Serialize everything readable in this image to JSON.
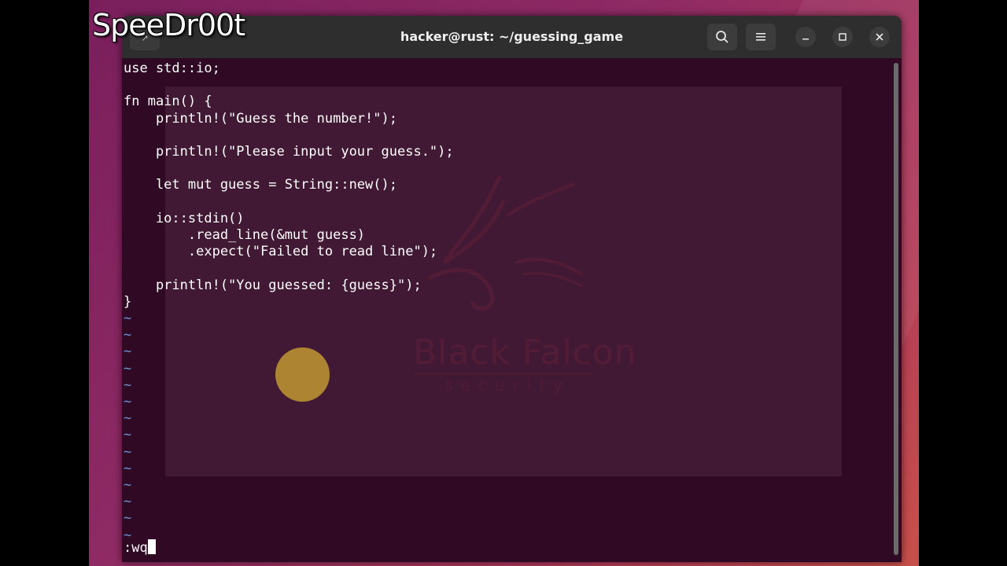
{
  "overlay": {
    "channel_name": "SpeeDr00t"
  },
  "window": {
    "title": "hacker@rust: ~/guessing_game",
    "new_tab_label": "↗",
    "icons": [
      "search-icon",
      "hamburger-menu-icon",
      "minimize-icon",
      "maximize-icon",
      "close-icon"
    ]
  },
  "editor": {
    "lines": [
      "use std::io;",
      "",
      "fn main() {",
      "    println!(\"Guess the number!\");",
      "",
      "    println!(\"Please input your guess.\");",
      "",
      "    let mut guess = String::new();",
      "",
      "    io::stdin()",
      "        .read_line(&mut guess)",
      "        .expect(\"Failed to read line\");",
      "",
      "    println!(\"You guessed: {guess}\");",
      "}"
    ],
    "empty_line_marker": "~",
    "command": ":wq"
  },
  "watermark": {
    "name": "Black Falcon",
    "subtitle": "security"
  },
  "colors": {
    "terminal_bg": "#300a24",
    "titlebar_bg": "#2e2e2e",
    "tilde": "#6d8fd6"
  }
}
